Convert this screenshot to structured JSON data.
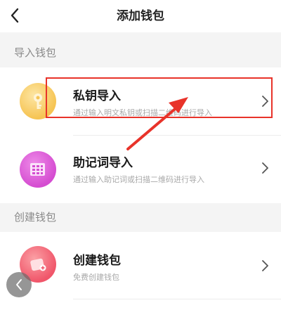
{
  "header": {
    "title": "添加钱包",
    "back_icon": "chevron-left-icon"
  },
  "sections": [
    {
      "label": "导入钱包",
      "items": [
        {
          "title": "私钥导入",
          "description": "通过输入明文私钥或扫描二维码进行导入",
          "icon": "key-icon",
          "icon_color": "#f6c453"
        },
        {
          "title": "助记词导入",
          "description": "通过输入助记词或扫描二维码进行导入",
          "icon": "mnemonic-grid-icon",
          "icon_color": "#d54dd1"
        }
      ]
    },
    {
      "label": "创建钱包",
      "items": [
        {
          "title": "创建钱包",
          "description": "免费创建钱包",
          "icon": "wallet-icon",
          "icon_color": "#f0566a"
        }
      ]
    }
  ],
  "annotation": {
    "highlight_color": "#e8332a",
    "arrow_color": "#e8332a"
  },
  "floating_back_icon": "chevron-left-icon"
}
